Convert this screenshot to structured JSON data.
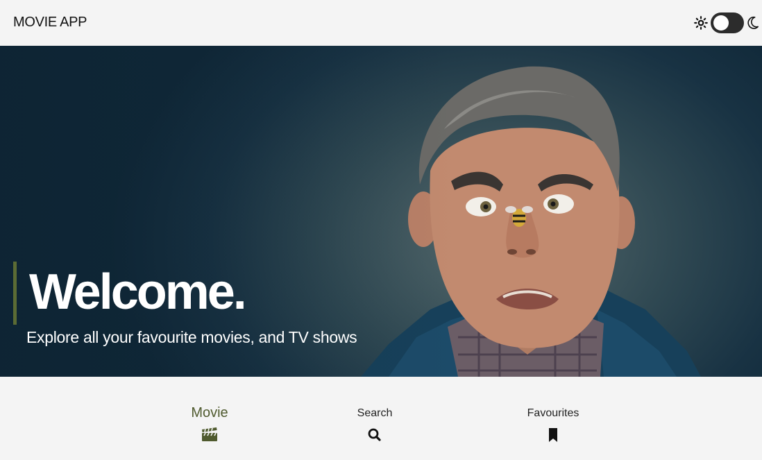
{
  "header": {
    "app_title": "MOVIE APP",
    "theme_toggle": {
      "left_icon": "sun-icon",
      "right_icon": "moon-icon",
      "state": "light"
    }
  },
  "hero": {
    "title": "Welcome.",
    "subtitle": "Explore all your favourite movies, and TV shows",
    "accent_color": "#5b6b34",
    "background_image": "portrait of a surprised man with a bee on his nose"
  },
  "nav": {
    "active_color": "#4f5a2e",
    "items": [
      {
        "label": "Movie",
        "icon": "clapperboard-icon",
        "active": true
      },
      {
        "label": "Search",
        "icon": "search-icon",
        "active": false
      },
      {
        "label": "Favourites",
        "icon": "bookmark-icon",
        "active": false
      }
    ]
  }
}
